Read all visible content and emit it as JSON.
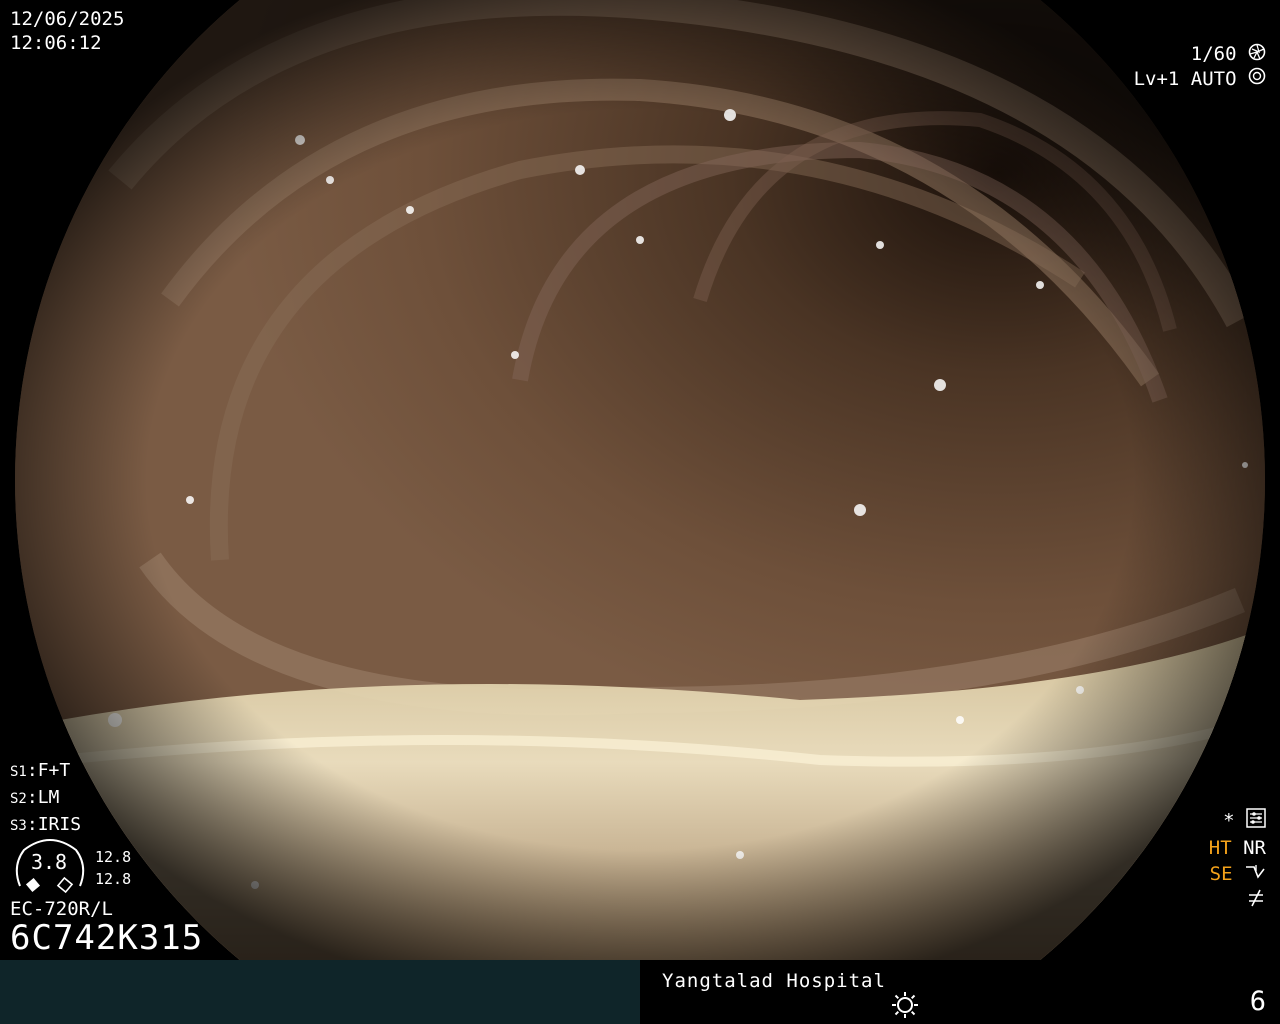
{
  "datetime": {
    "date": "12/06/2025",
    "time": "12:06:12"
  },
  "top_right": {
    "shutter": "1/60",
    "level": "Lv+1",
    "mode": "AUTO"
  },
  "settings": [
    {
      "key": "S1",
      "value": "F+T"
    },
    {
      "key": "S2",
      "value": "LM"
    },
    {
      "key": "S3",
      "value": "IRIS"
    }
  ],
  "gauge": {
    "value": "3.8",
    "side_top": "12.8",
    "side_bottom": "12.8"
  },
  "scope": {
    "model": "EC-720R/L",
    "id": "6C742K315"
  },
  "bottom_right": {
    "star": "*",
    "ht": "HT",
    "nr": "NR",
    "se": "SE"
  },
  "footer": {
    "hospital": "Yangtalad Hospital",
    "page": "6"
  },
  "colors": {
    "accent_orange": "#f4a21a",
    "bar_left": "#0f2529"
  }
}
